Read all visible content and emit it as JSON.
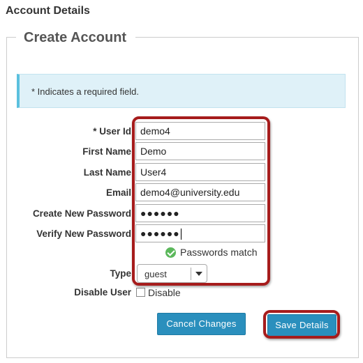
{
  "page": {
    "title": "Account Details",
    "legend": "Create Account"
  },
  "info": {
    "required_note": "* Indicates a required field."
  },
  "form": {
    "user_id": {
      "label": "* User Id",
      "value": "demo4"
    },
    "first_name": {
      "label": "First Name",
      "value": "Demo"
    },
    "last_name": {
      "label": "Last Name",
      "value": "User4"
    },
    "email": {
      "label": "Email",
      "value": "demo4@university.edu"
    },
    "new_password": {
      "label": "Create New Password",
      "value": "●●●●●●"
    },
    "verify_password": {
      "label": "Verify New Password",
      "value": "●●●●●●"
    },
    "password_status": "Passwords match",
    "type": {
      "label": "Type",
      "selected": "guest"
    },
    "disable_user": {
      "label": "Disable User",
      "option_label": "Disable"
    }
  },
  "buttons": {
    "cancel": "Cancel Changes",
    "save": "Save Details"
  },
  "colors": {
    "button_blue": "#2a8fbd",
    "info_bg": "#dff1f8",
    "info_border": "#5bc0de",
    "highlight_red": "#a61c1c",
    "success_green": "#5cb85c"
  }
}
